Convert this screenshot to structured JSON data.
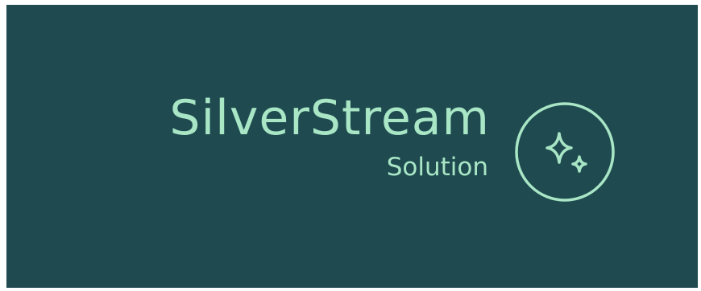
{
  "logo": {
    "name": "SilverStream",
    "tagline": "Solution",
    "emblem_icon": "sparkle-icon",
    "colors": {
      "background": "#1f4a4f",
      "foreground": "#a8e6c6"
    }
  }
}
